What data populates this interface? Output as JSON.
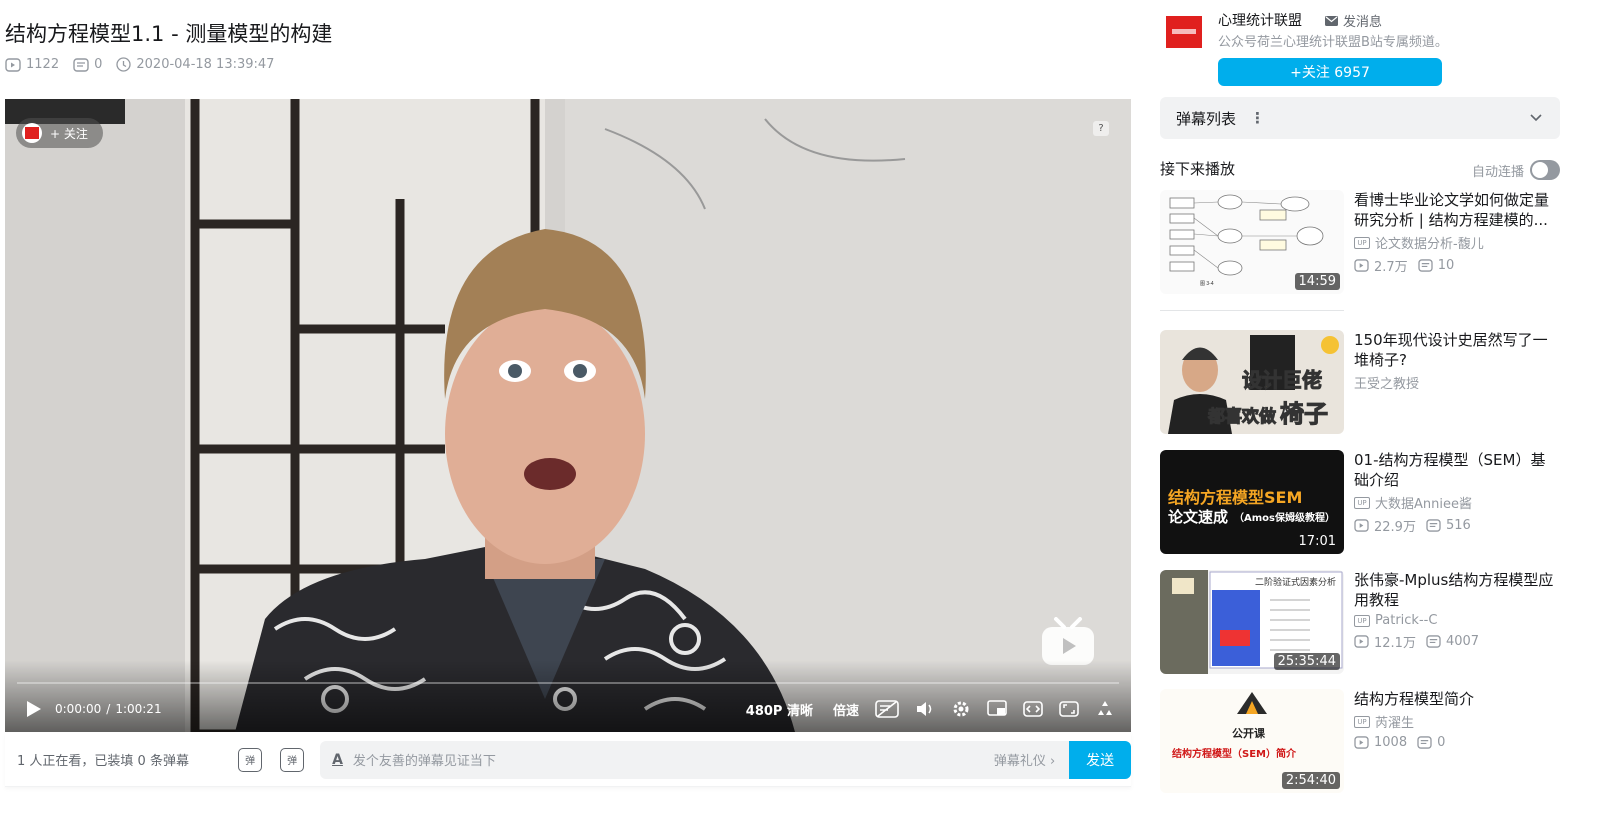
{
  "video": {
    "title": "结构方程模型1.1 - 测量模型的构建",
    "plays": "1122",
    "danmaku_count": "0",
    "pubdate": "2020-04-18 13:39:47"
  },
  "player": {
    "follow_label": "+ 关注",
    "help_label": "?",
    "current_time": "0:00:00",
    "time_sep": "/",
    "duration": "1:00:21",
    "quality": "480P 清晰",
    "speed": "倍速",
    "progress": 0
  },
  "danmaku_bar": {
    "viewers_text": "1 人正在看，已装填 0 条弹幕",
    "icon1_label": "弹",
    "icon2_label": "弹",
    "input_placeholder": "发个友善的弹幕见证当下",
    "input_icon": "A",
    "gift_label": "弹幕礼仪 ›",
    "send_label": "发送"
  },
  "uploader": {
    "name": "心理统计联盟",
    "message_label": "发消息",
    "description": "公众号荷兰心理统计联盟B站专属频道。",
    "follow_label": "+关注 6957"
  },
  "sidebar": {
    "danmaku_list_label": "弹幕列表",
    "danmaku_menu": "⋮",
    "next_label": "接下来播放",
    "autoplay_label": "自动连播",
    "autoplay_on": false
  },
  "recommendations": [
    {
      "title": "看博士毕业论文学如何做定量研究分析 | 结构方程建模的...",
      "up": "论文数据分析-馥儿",
      "plays": "2.7万",
      "danmaku": "10",
      "duration": "14:59"
    },
    {
      "title": "150年现代设计史居然写了一堆椅子?",
      "up": "王受之教授",
      "plays": "",
      "danmaku": "",
      "duration": "",
      "thumb_text1": "设计巨佬",
      "thumb_text2": "都喜欢做",
      "thumb_text3": "椅子"
    },
    {
      "title": "01-结构方程模型（SEM）基础介绍",
      "up": "大数据Anniee酱",
      "plays": "22.9万",
      "danmaku": "516",
      "duration": "17:01",
      "thumb_text1": "结构方程模型SEM",
      "thumb_text2": "论文速成",
      "thumb_text3": "（Amos保姆级教程）"
    },
    {
      "title": "张伟豪-Mplus结构方程模型应用教程",
      "up": "Patrick--C",
      "plays": "12.1万",
      "danmaku": "4007",
      "duration": "25:35:44",
      "thumb_text1": "二阶验证式因素分析"
    },
    {
      "title": "结构方程模型简介",
      "up": "芮濯生",
      "plays": "1008",
      "danmaku": "0",
      "duration": "2:54:40",
      "thumb_text1": "结构方程模型（SEM）简介",
      "thumb_text2": "公开课"
    }
  ]
}
